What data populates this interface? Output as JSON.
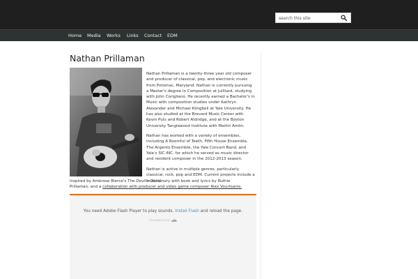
{
  "search": {
    "placeholder": "search this site",
    "icon": "search-icon"
  },
  "nav": {
    "items": [
      {
        "label": "Home"
      },
      {
        "label": "Media"
      },
      {
        "label": "Works"
      },
      {
        "label": "Links"
      },
      {
        "label": "Contact"
      },
      {
        "label": "EDM"
      }
    ]
  },
  "page": {
    "title": "Nathan Prillaman",
    "bio_p1": "Nathan Prillaman is a twenty-three year old composer and producer of classical, pop, and electronic music from Potomac, Maryland.  Nathan is currently pursuing a Master's degree in Composition at Juilliard, studying with John Corigliano.  He recently earned a Bachelor's in Music with composition studies under Kathryn Alexander and Michael Klingbeil at Yale University.  He has also studied at the Brevard Music Center with Kevin Puts and Robert Aldridge, and at the Boston University Tanglewood Institute with Martin Amlin.",
    "bio_p2": "Nathan has worked with a variety of ensembles, including A Roomful of Teeth, Fifth House Ensemble, The Argento Ensemble, the Yale Concert Band, and Yale's SIC INC, for which he served as music director and resident composer in the 2012-2013 season.",
    "bio_p3_part1": "Nathan is active in multiple genres, particularly classical, rock, pop and EDM.  Current projects include a musical",
    "bio_p3_part2": "inspired by Ambrose Bierce's ",
    "bio_p3_italic": "The Devil's Dictionary",
    "bio_p3_part3": " with book and lyrics by Ruthie Prillaman, and a ",
    "bio_p3_link": "collaboration with producer and video game composer Alex Vourtsanis.",
    "photo_subject": "portrait of Nathan Prillaman with guitar"
  },
  "player": {
    "msg_part1": "You need Adobe Flash Player to play sounds. ",
    "msg_link": "Install Flash",
    "msg_part2": " and reload the page.",
    "brand": "SOUNDCLOUD",
    "accent_color": "#e06d1a"
  },
  "colors": {
    "topbar": "#1f1f1f",
    "navbar": "#2d3332",
    "link_blue": "#3b8fd1"
  }
}
